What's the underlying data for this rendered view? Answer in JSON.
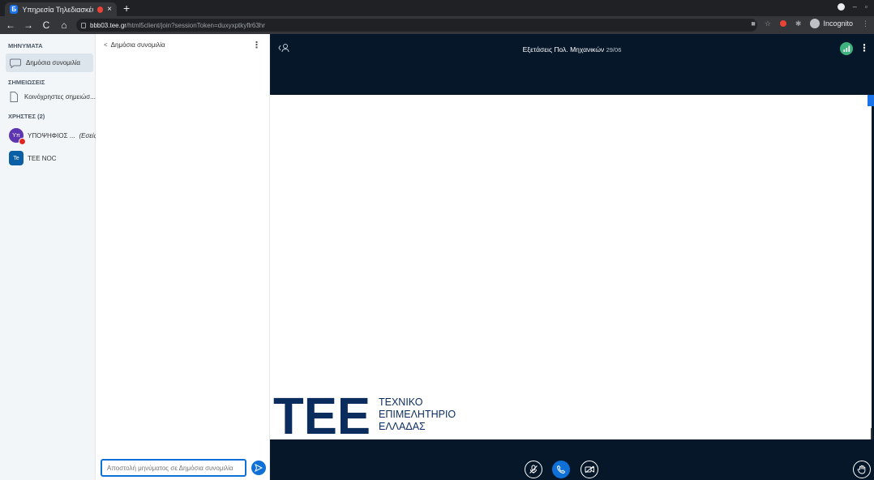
{
  "browser": {
    "tab_title": "Υπηρεσία Τηλεδιασκέψ",
    "tab_favicon_letter": "Ƃ",
    "close_glyph": "×",
    "new_tab_glyph": "+",
    "url_host": "bbb03.tee.gr",
    "url_path": "/html5client/join?sessionToken=duxyxptkyflr63hr",
    "incognito_label": "Incognito",
    "nav_back": "←",
    "nav_forward": "→",
    "nav_reload": "C",
    "nav_home": "⌂"
  },
  "sidebar": {
    "messages_title": "ΜΗΝΥΜΑΤΑ",
    "public_chat_label": "Δημόσια συνομιλία",
    "notes_title": "ΣΗΜΕΙΩΣΕΙΣ",
    "shared_notes_label": "Κοινόχρηστες σημειώσ...",
    "users_title": "ΧΡΗΣΤΕΣ (2)",
    "users": [
      {
        "initials": "Υπ",
        "name": "ΥΠΟΨΗΦΙΟΣ ...",
        "suffix": "(Εσείς)"
      },
      {
        "initials": "Te",
        "name": "TEE NOC",
        "suffix": ""
      }
    ]
  },
  "chat": {
    "back_label": "Δημόσια συνομιλία",
    "back_glyph": "<",
    "options_glyph": "⋮",
    "input_placeholder": "Αποστολή μηνύματος σε Δημόσια συνομιλία"
  },
  "main": {
    "meeting_title": "Εξετάσεις Πολ. Μηχανικών",
    "meeting_date": "29/06",
    "options_glyph": "⋮",
    "logo_mark": "TEE",
    "logo_lines": [
      "ΤΕΧΝΙΚΟ",
      "ΕΠΙΜΕΛΗΤΗΡΙΟ",
      "ΕΛΛΑΔΑΣ"
    ]
  },
  "colors": {
    "accent": "#0f70d7",
    "main_bg": "#06172a",
    "sidebar_bg": "#f3f6f9",
    "status_green": "#3fb37f",
    "badge_red": "#df2721",
    "logo_blue": "#0b2d5e"
  },
  "icons": {
    "public_chat": "chat-bubble-icon",
    "shared_notes": "document-icon",
    "users_toggle": "users-icon",
    "connection": "signal-bars-icon",
    "mic": "mic-muted-icon",
    "phone": "phone-icon",
    "video": "video-off-icon",
    "hand": "raise-hand-icon",
    "send": "send-icon"
  }
}
